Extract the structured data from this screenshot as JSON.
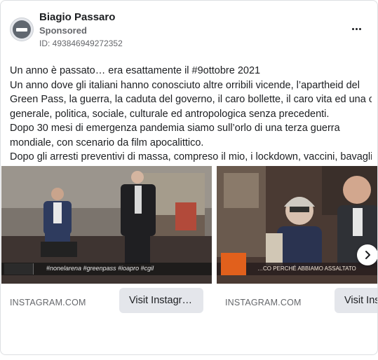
{
  "post": {
    "page_name": "Biagio Passaro",
    "sponsored_label": "Sponsored",
    "ad_id": "ID: 493846949272352",
    "more_icon": "more-horizontal-icon",
    "text_lines": [
      "Un anno è passato… era esattamente il #9ottobre 2021",
      "Un anno dove gli italiani hanno conosciuto altre orribili vicende, l’apartheid del",
      "Green Pass, la guerra, la caduta del governo, il caro bollette, il caro vita ed una crisi",
      "generale, politica, sociale, culturale ed antropologica senza precedenti.",
      "Dopo 30 mesi di emergenza pandemia siamo sull’orlo di una terza guerra",
      "mondiale, con scenario da film apocalittico.",
      "Dopo gli arresti preventivi di massa, compreso il mio, i lockdown, vaccini, bavagli,…"
    ]
  },
  "carousel": {
    "cards": [
      {
        "domain": "INSTAGRAM.COM",
        "button_label": "Visit Instagr…",
        "overlay_text": "#nonelarena #greenpass #ioapro #cgil"
      },
      {
        "domain": "INSTAGRAM.COM",
        "button_label": "Visit Ins",
        "overlay_text": "…CO PERCHÉ ABBIAMO ASSALTATO"
      }
    ],
    "next_icon": "chevron-right-icon"
  }
}
